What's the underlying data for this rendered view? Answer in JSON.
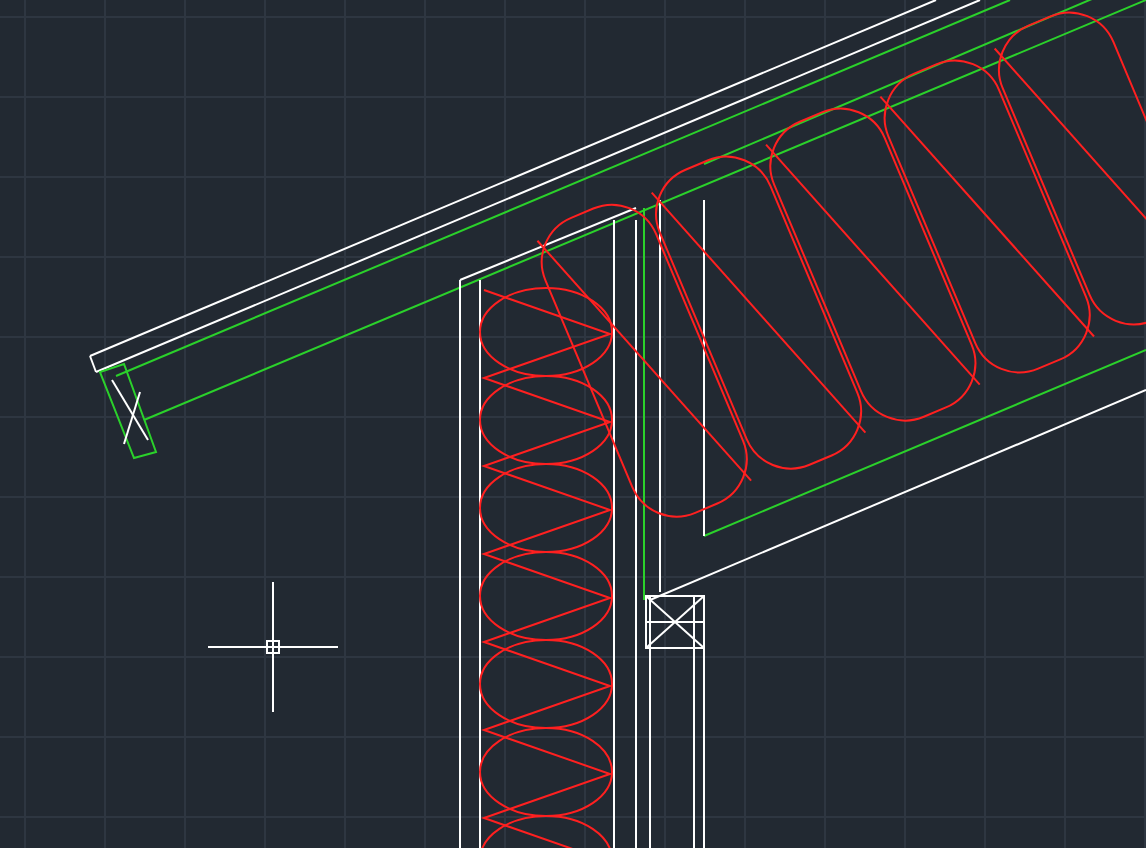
{
  "viewport": {
    "kind": "model-space"
  },
  "cursor": {
    "kind": "crosshair"
  }
}
